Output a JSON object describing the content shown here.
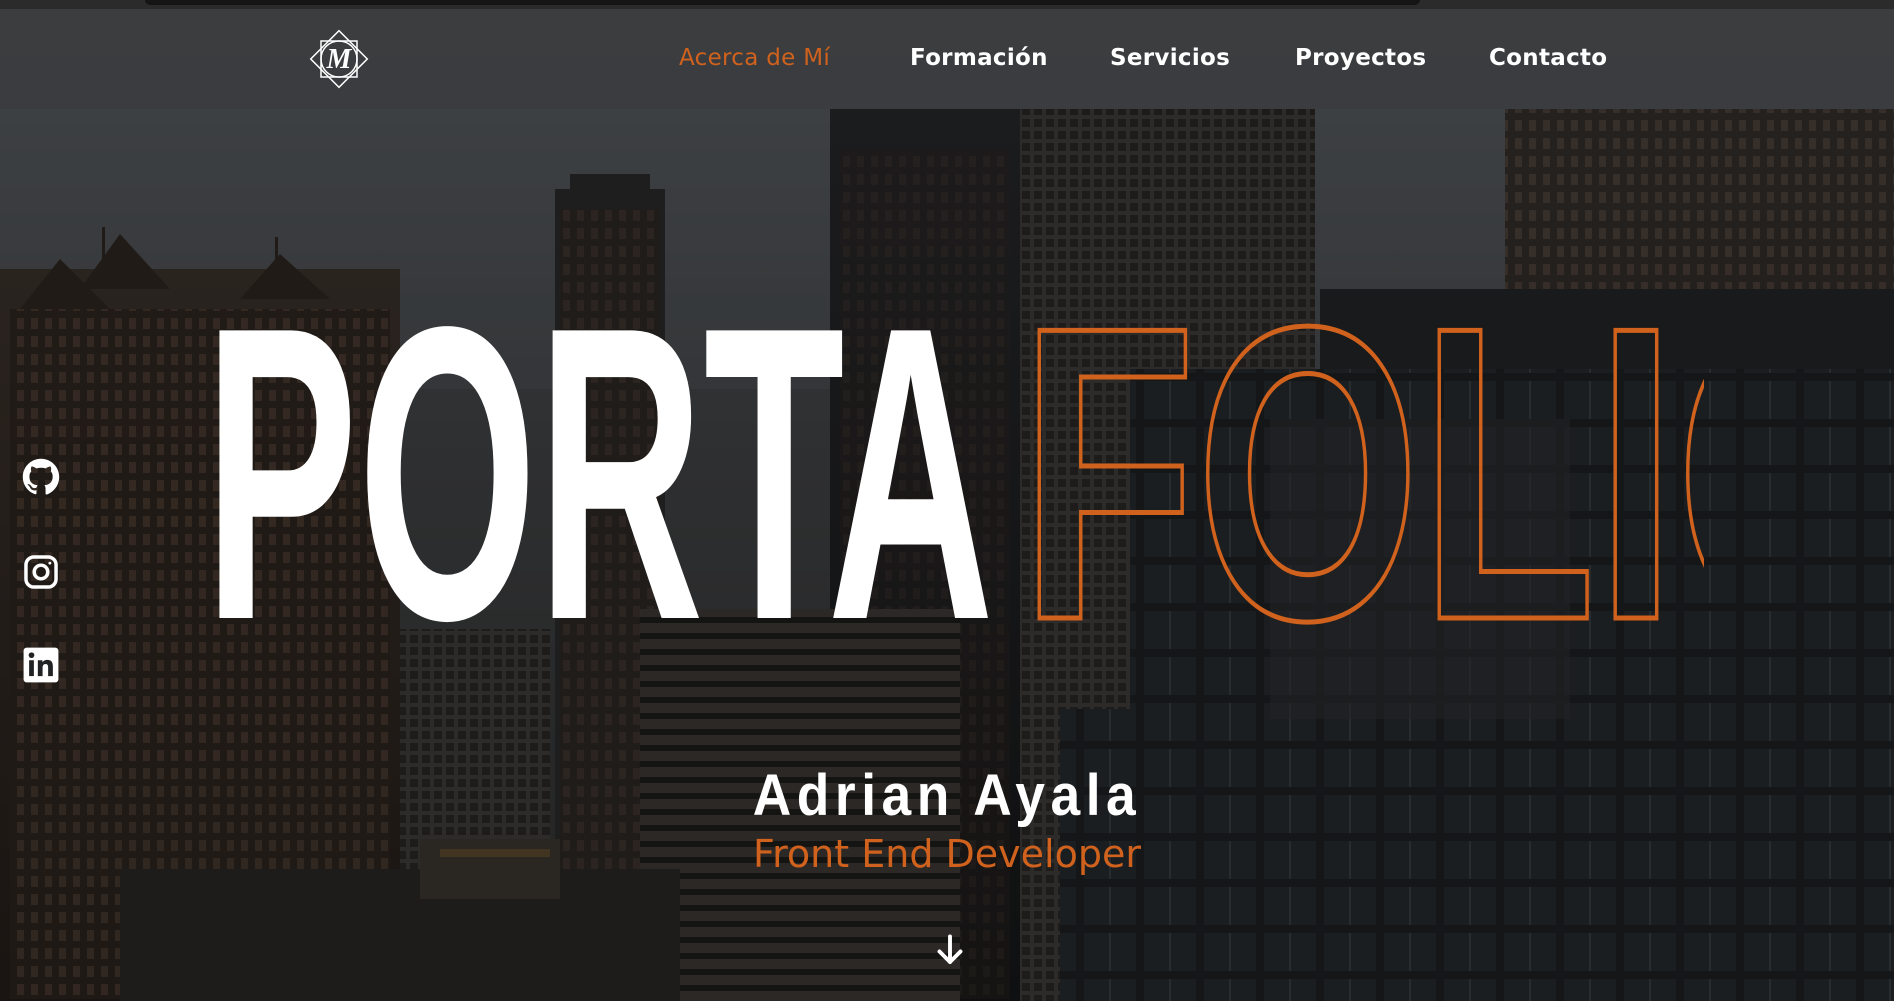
{
  "brand": {
    "logo_letter": "M"
  },
  "nav": {
    "items": [
      {
        "label": "Acerca de Mí",
        "active": true
      },
      {
        "label": "Formación",
        "active": false
      },
      {
        "label": "Servicios",
        "active": false
      },
      {
        "label": "Proyectos",
        "active": false
      },
      {
        "label": "Contacto",
        "active": false
      }
    ]
  },
  "social": {
    "items": [
      {
        "icon": "github-icon"
      },
      {
        "icon": "instagram-icon"
      },
      {
        "icon": "linkedin-icon"
      }
    ]
  },
  "hero": {
    "title_solid": "PORTA",
    "title_outline": "FOLIO",
    "name": "Adrian Ayala",
    "role": "Front End Developer",
    "scroll_icon": "arrow-down-icon"
  },
  "colors": {
    "accent": "#d0621d",
    "navbar_bg": "#3a3c3e",
    "text_primary": "#ffffff",
    "background": "#202224"
  }
}
